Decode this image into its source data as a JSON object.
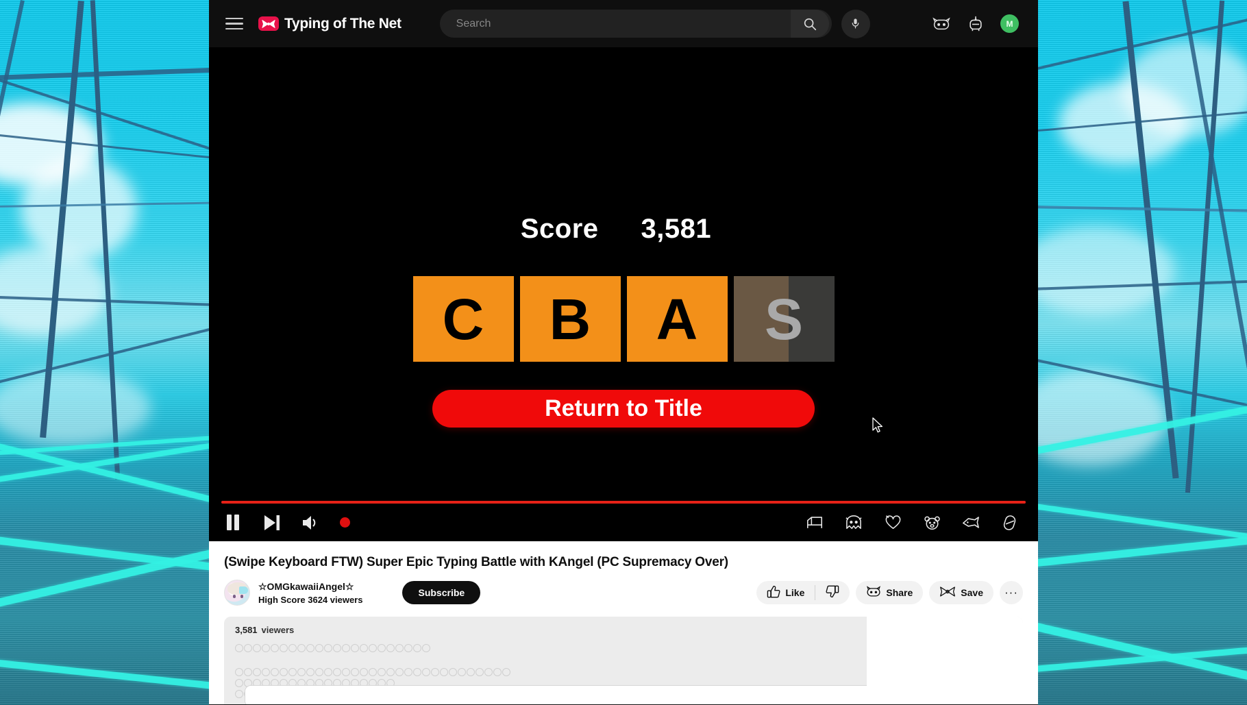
{
  "header": {
    "menu_label": "Menu",
    "brand_title": "Typing of The Net",
    "brand_icon": "bow-logo-icon",
    "search": {
      "value": "",
      "placeholder": "Search",
      "button_icon": "search-icon"
    },
    "mic_icon": "microphone-icon",
    "icons": [
      {
        "name": "cat-face-icon",
        "label": "Create"
      },
      {
        "name": "robot-head-icon",
        "label": "Notifications"
      }
    ],
    "avatar_initial": "M"
  },
  "player": {
    "game": {
      "score_label": "Score",
      "score_value": "3,581",
      "grades": [
        {
          "letter": "C",
          "achieved": true
        },
        {
          "letter": "B",
          "achieved": true
        },
        {
          "letter": "A",
          "achieved": true
        },
        {
          "letter": "S",
          "achieved": false,
          "progress_pct": 55
        }
      ],
      "return_button": "Return to Title"
    },
    "progress_pct": 100,
    "controls_left": [
      {
        "name": "pause-button",
        "icon": "pause-icon"
      },
      {
        "name": "next-button",
        "icon": "next-track-icon"
      },
      {
        "name": "volume-button",
        "icon": "volume-icon"
      },
      {
        "name": "live-indicator",
        "icon": "red-dot-icon"
      }
    ],
    "controls_right": [
      {
        "name": "autoplay-button",
        "icon": "bed-shape-icon"
      },
      {
        "name": "captions-button",
        "icon": "ghost-icon"
      },
      {
        "name": "settings-button",
        "icon": "heart-icon"
      },
      {
        "name": "miniplayer-button",
        "icon": "bear-face-icon"
      },
      {
        "name": "theater-button",
        "icon": "fish-icon"
      },
      {
        "name": "fullscreen-button",
        "icon": "capsule-icon"
      }
    ]
  },
  "video": {
    "title": "(Swipe Keyboard FTW) Super Epic Typing Battle with KAngel (PC Supremacy Over)",
    "channel_name": "☆OMGkawaiiAngel☆",
    "channel_sub": "High Score 3624 viewers",
    "subscribe_label": "Subscribe",
    "actions": {
      "like_label": "Like",
      "like_icon": "thumbs-up-icon",
      "dislike_icon": "thumbs-down-icon",
      "share_label": "Share",
      "share_icon": "cat-face-icon",
      "save_label": "Save",
      "save_icon": "bow-icon",
      "more_label": "···"
    }
  },
  "chat": {
    "viewers_count": "3,581",
    "viewers_unit": "viewers",
    "redacted_rows": [
      22,
      0,
      31,
      18,
      3
    ],
    "input_placeholder": ""
  },
  "colors": {
    "brand_red": "#e8124a",
    "accent_orange": "#f39019",
    "button_red": "#f00a0a",
    "progress_red": "#e62117",
    "avatar_green": "#3fbf62",
    "sky_cyan": "#12cdf0"
  }
}
